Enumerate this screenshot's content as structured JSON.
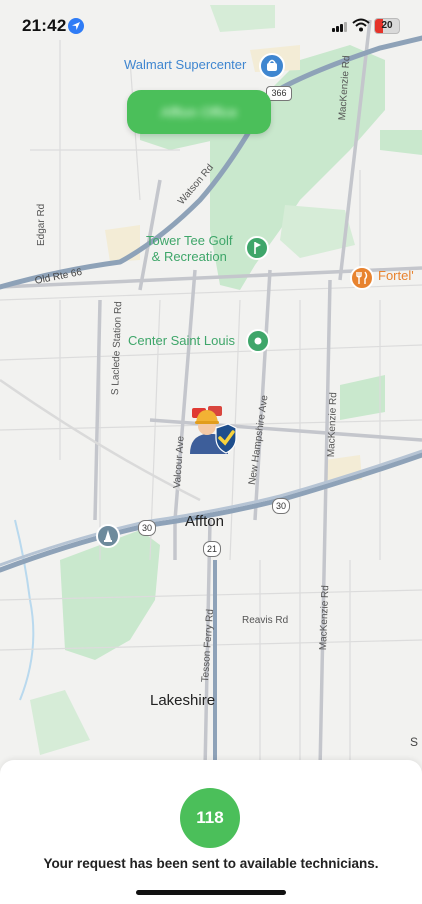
{
  "status_bar": {
    "time": "21:42",
    "battery_level": "20"
  },
  "map": {
    "pois": {
      "walmart": "Walmart Supercenter",
      "tower_tee_line1": "Tower Tee Golf",
      "tower_tee_line2": "& Recreation",
      "fortel": "Fortel'",
      "center_st_louis": "Center Saint Louis"
    },
    "streets": {
      "mackenzie": "MacKenzie Rd",
      "watson": "Watson Rd",
      "edgar": "Edgar Rd",
      "old_rte_66": "Old Rte 66",
      "s_laclede": "S Laclede Station Rd",
      "new_hampshire": "New Hampshire Ave",
      "valcour": "Valcour Ave",
      "tesson_ferry": "Tesson Ferry Rd",
      "reavis": "Reavis Rd"
    },
    "shields": {
      "r366": "366",
      "r30a": "30",
      "r30b": "30",
      "r21": "21"
    },
    "places": {
      "affton": "Affton",
      "lakeshire": "Lakeshire",
      "edge_s": "S"
    },
    "office_badge": "Affton Office",
    "icons": {
      "technician_marker": "technician-shield-icon",
      "location_arrow": "location-arrow-icon"
    }
  },
  "sheet": {
    "count": "118",
    "message": "Your request has been sent to available technicians."
  },
  "colors": {
    "accent_green": "#4bbf5a",
    "poi_blue": "#3f86d0",
    "poi_green": "#3fa66a",
    "poi_orange": "#e8832f"
  }
}
